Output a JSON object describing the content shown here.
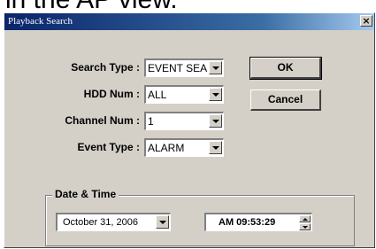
{
  "background_text": "in the AP view.",
  "window": {
    "title": "Playback Search",
    "close_label": "×"
  },
  "form": {
    "search_type": {
      "label": "Search Type :",
      "value": "EVENT SEA"
    },
    "hdd_num": {
      "label": "HDD Num :",
      "value": "ALL"
    },
    "channel_num": {
      "label": "Channel Num :",
      "value": "1"
    },
    "event_type": {
      "label": "Event Type :",
      "value": "ALARM"
    }
  },
  "buttons": {
    "ok": "OK",
    "cancel": "Cancel"
  },
  "date_time": {
    "group_label": "Date & Time",
    "date": "October 31, 2006",
    "time": "AM 09:53:29"
  },
  "colors": {
    "dialog_face": "#d4d0c8",
    "title_bar": "#0a246a"
  }
}
